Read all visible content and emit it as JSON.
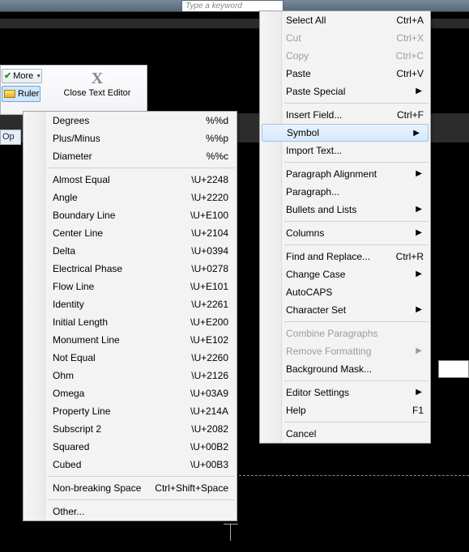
{
  "search_placeholder": "Type a keyword",
  "ribbon": {
    "more": "More",
    "ruler": "Ruler",
    "close_editor": "Close Text Editor",
    "op": "Op"
  },
  "context_menu": [
    {
      "label": "Select All",
      "shortcut": "Ctrl+A",
      "disabled": false,
      "type": "item"
    },
    {
      "label": "Cut",
      "shortcut": "Ctrl+X",
      "disabled": true,
      "type": "item"
    },
    {
      "label": "Copy",
      "shortcut": "Ctrl+C",
      "disabled": true,
      "type": "item"
    },
    {
      "label": "Paste",
      "shortcut": "Ctrl+V",
      "disabled": false,
      "type": "item"
    },
    {
      "label": "Paste Special",
      "submenu": true,
      "type": "item"
    },
    {
      "type": "sep"
    },
    {
      "label": "Insert Field...",
      "shortcut": "Ctrl+F",
      "type": "item"
    },
    {
      "label": "Symbol",
      "submenu": true,
      "highlight": true,
      "type": "item"
    },
    {
      "label": "Import Text...",
      "type": "item"
    },
    {
      "type": "sep"
    },
    {
      "label": "Paragraph Alignment",
      "submenu": true,
      "type": "item"
    },
    {
      "label": "Paragraph...",
      "type": "item"
    },
    {
      "label": "Bullets and Lists",
      "submenu": true,
      "type": "item"
    },
    {
      "type": "sep"
    },
    {
      "label": "Columns",
      "submenu": true,
      "type": "item"
    },
    {
      "type": "sep"
    },
    {
      "label": "Find and Replace...",
      "shortcut": "Ctrl+R",
      "type": "item"
    },
    {
      "label": "Change Case",
      "submenu": true,
      "type": "item"
    },
    {
      "label": "AutoCAPS",
      "type": "item"
    },
    {
      "label": "Character Set",
      "submenu": true,
      "type": "item"
    },
    {
      "type": "sep"
    },
    {
      "label": "Combine Paragraphs",
      "disabled": true,
      "type": "item"
    },
    {
      "label": "Remove Formatting",
      "submenu": true,
      "disabled": true,
      "type": "item"
    },
    {
      "label": "Background Mask...",
      "type": "item"
    },
    {
      "type": "sep"
    },
    {
      "label": "Editor Settings",
      "submenu": true,
      "type": "item"
    },
    {
      "label": "Help",
      "shortcut": "F1",
      "type": "item"
    },
    {
      "type": "sep"
    },
    {
      "label": "Cancel",
      "type": "item"
    }
  ],
  "symbol_menu": [
    {
      "label": "Degrees",
      "code": "%%d",
      "type": "item"
    },
    {
      "label": "Plus/Minus",
      "code": "%%p",
      "type": "item"
    },
    {
      "label": "Diameter",
      "code": "%%c",
      "type": "item"
    },
    {
      "type": "sep"
    },
    {
      "label": "Almost Equal",
      "code": "\\U+2248",
      "type": "item"
    },
    {
      "label": "Angle",
      "code": "\\U+2220",
      "type": "item"
    },
    {
      "label": "Boundary Line",
      "code": "\\U+E100",
      "type": "item"
    },
    {
      "label": "Center Line",
      "code": "\\U+2104",
      "type": "item"
    },
    {
      "label": "Delta",
      "code": "\\U+0394",
      "type": "item"
    },
    {
      "label": "Electrical Phase",
      "code": "\\U+0278",
      "type": "item"
    },
    {
      "label": "Flow Line",
      "code": "\\U+E101",
      "type": "item"
    },
    {
      "label": "Identity",
      "code": "\\U+2261",
      "type": "item"
    },
    {
      "label": "Initial Length",
      "code": "\\U+E200",
      "type": "item"
    },
    {
      "label": "Monument Line",
      "code": "\\U+E102",
      "type": "item"
    },
    {
      "label": "Not Equal",
      "code": "\\U+2260",
      "type": "item"
    },
    {
      "label": "Ohm",
      "code": "\\U+2126",
      "type": "item"
    },
    {
      "label": "Omega",
      "code": "\\U+03A9",
      "type": "item"
    },
    {
      "label": "Property Line",
      "code": "\\U+214A",
      "type": "item"
    },
    {
      "label": "Subscript 2",
      "code": "\\U+2082",
      "type": "item"
    },
    {
      "label": "Squared",
      "code": "\\U+00B2",
      "type": "item"
    },
    {
      "label": "Cubed",
      "code": "\\U+00B3",
      "type": "item"
    },
    {
      "type": "sep"
    },
    {
      "label": "Non-breaking Space",
      "code": "Ctrl+Shift+Space",
      "type": "item"
    },
    {
      "type": "sep"
    },
    {
      "label": "Other...",
      "type": "item"
    }
  ]
}
